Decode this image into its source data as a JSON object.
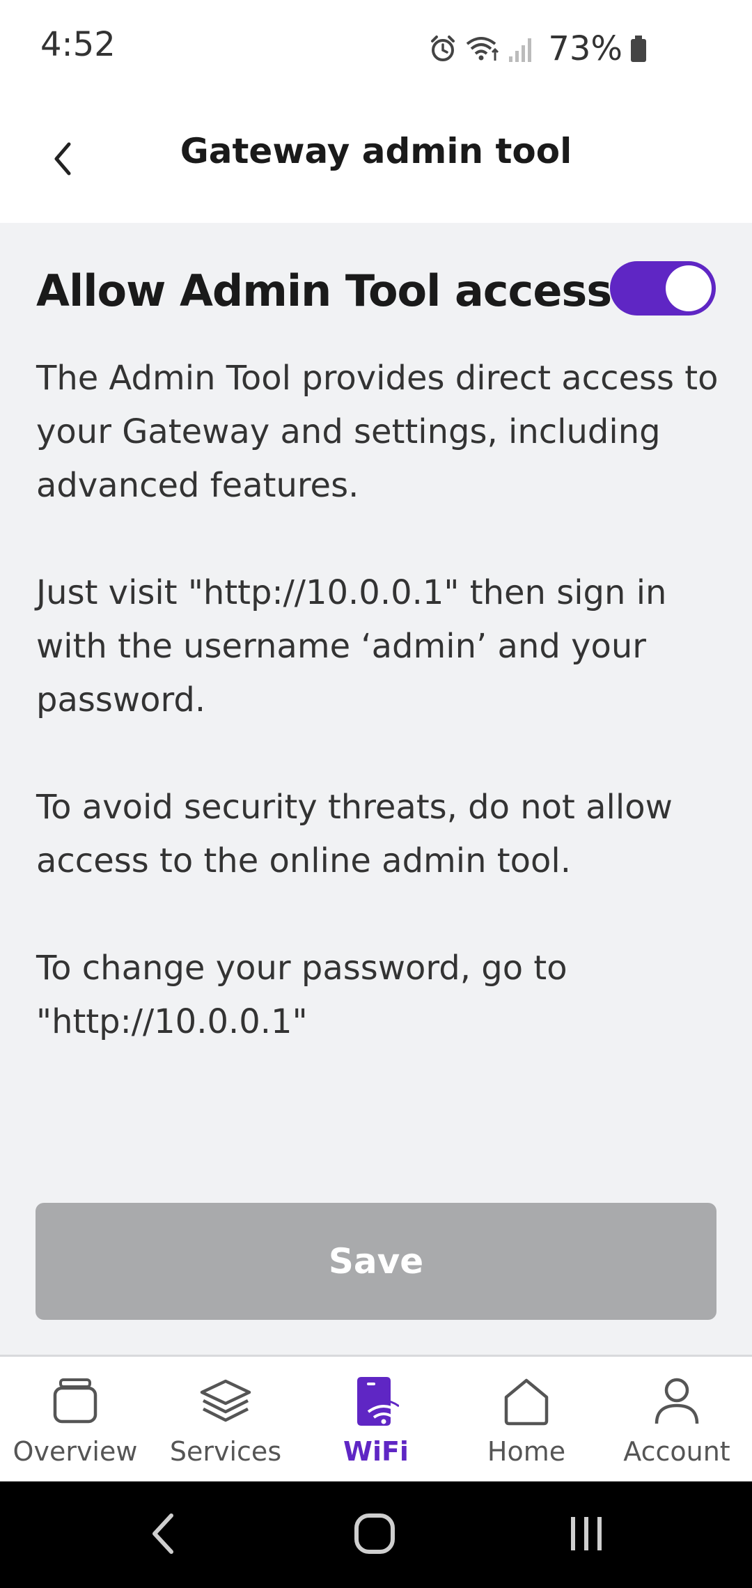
{
  "status_bar": {
    "time": "4:52",
    "battery": "73%",
    "icons": [
      "alarm-icon",
      "wifi-icon",
      "signal-icon",
      "battery-icon"
    ]
  },
  "header": {
    "title": "Gateway admin tool",
    "back_icon": "chevron-left-icon"
  },
  "admin_access": {
    "label": "Allow Admin Tool access",
    "enabled": true,
    "paragraphs": [
      "The Admin Tool provides direct access to your Gateway and settings, including advanced features.",
      "Just visit \"http://10.0.0.1\" then sign in with the username ‘admin’ and your password.",
      "To avoid security threats, do not allow access to the online admin tool.",
      "To change your password, go to \"http://10.0.0.1\""
    ]
  },
  "save_label": "Save",
  "bottom_nav": {
    "items": [
      {
        "label": "Overview",
        "icon": "overview-icon"
      },
      {
        "label": "Services",
        "icon": "layers-icon"
      },
      {
        "label": "WiFi",
        "icon": "wifi-gateway-icon",
        "active": true
      },
      {
        "label": "Home",
        "icon": "home-icon"
      },
      {
        "label": "Account",
        "icon": "person-icon"
      }
    ]
  },
  "colors": {
    "accent": "#5f26c4",
    "background": "#f1f2f4",
    "save_disabled": "#a9aaac"
  }
}
